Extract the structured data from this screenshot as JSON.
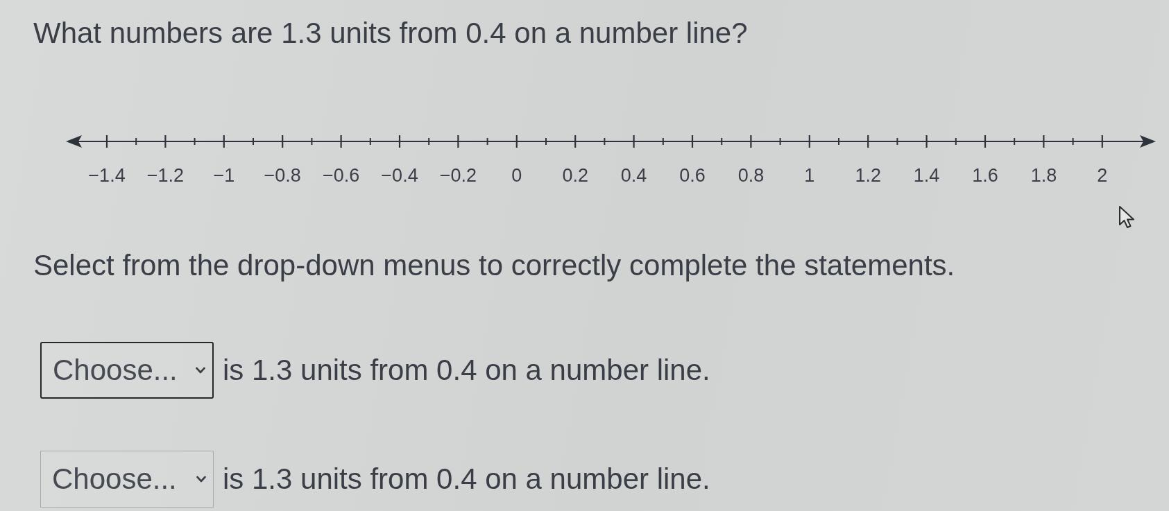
{
  "question": "What numbers are 1.3 units from 0.4 on a number line?",
  "number_line": {
    "tick_labels": [
      "−1.4",
      "−1.2",
      "−1",
      "−0.8",
      "−0.6",
      "−0.4",
      "−0.2",
      "0",
      "0.2",
      "0.4",
      "0.6",
      "0.8",
      "1",
      "1.2",
      "1.4",
      "1.6",
      "1.8",
      "2"
    ]
  },
  "instruction": "Select from the drop-down menus to correctly complete the statements.",
  "statements": [
    {
      "dropdown": {
        "placeholder": "Choose...",
        "focused": true
      },
      "text": "is 1.3 units from 0.4 on a number line."
    },
    {
      "dropdown": {
        "placeholder": "Choose...",
        "focused": false
      },
      "text": "is 1.3 units from 0.4 on a number line."
    }
  ]
}
